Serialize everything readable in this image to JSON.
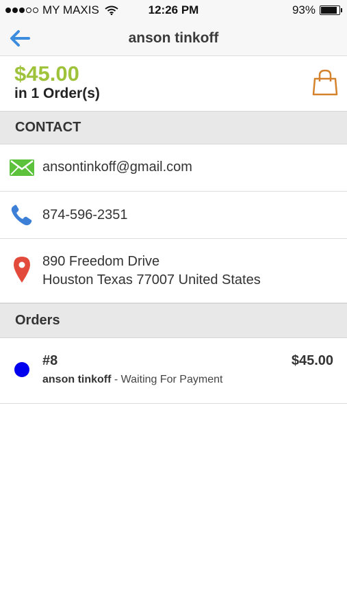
{
  "status_bar": {
    "carrier": "MY MAXIS",
    "time": "12:26 PM",
    "battery": "93%",
    "battery_level": 0.93
  },
  "header": {
    "title": "anson tinkoff",
    "back_icon": "back-arrow-icon"
  },
  "summary": {
    "amount": "$45.00",
    "orders_count": "in 1 Order(s)",
    "bag_icon": "shopping-bag-icon",
    "amount_color": "#9ec23a"
  },
  "contact": {
    "section_title": "CONTACT",
    "email": "ansontinkoff@gmail.com",
    "phone": "874-596-2351",
    "address_line1": "890 Freedom Drive",
    "address_line2": "Houston Texas 77007 United States",
    "icons": {
      "email": "envelope-icon",
      "phone": "phone-icon",
      "address": "map-pin-icon"
    }
  },
  "orders": {
    "section_title": "Orders",
    "items": [
      {
        "number": "#8",
        "amount": "$45.00",
        "customer": "anson tinkoff",
        "status": " - Waiting For Payment",
        "status_color": "#0000ee"
      }
    ]
  }
}
